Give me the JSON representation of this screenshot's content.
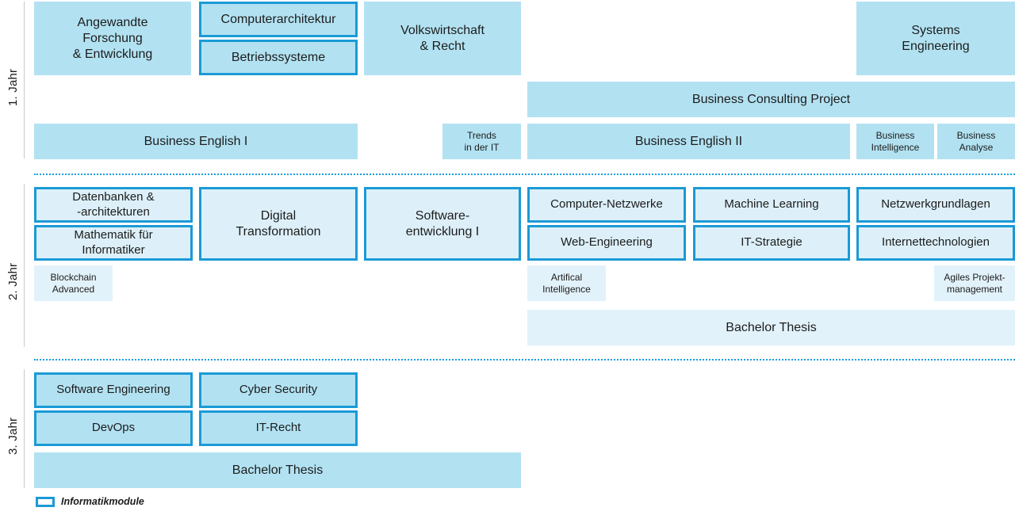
{
  "legend": {
    "swatch_label": "Informatikmodule",
    "swatch_border_color": "#1b9ad6"
  },
  "colors": {
    "accent": "#1b9ad6",
    "fill_strong": "#b2e2f2",
    "fill_soft": "#ddf0f9",
    "separator": "#14a0de",
    "text": "#1c1c1c"
  },
  "years": [
    {
      "label": "1. Jahr",
      "modules": [
        {
          "name": "Angewandte\nForschung\n& Entwicklung",
          "informatik": false
        },
        {
          "name": "Computerarchitektur",
          "informatik": true
        },
        {
          "name": "Betriebssysteme",
          "informatik": true
        },
        {
          "name": "Volkswirtschaft\n& Recht",
          "informatik": false
        },
        {
          "name": "Systems\nEngineering",
          "informatik": false
        },
        {
          "name": "Business Consulting Project",
          "informatik": false
        },
        {
          "name": "Business English I",
          "informatik": false
        },
        {
          "name": "Trends\nin der IT",
          "informatik": false
        },
        {
          "name": "Business English II",
          "informatik": false
        },
        {
          "name": "Business\nIntelligence",
          "informatik": false
        },
        {
          "name": "Business\nAnalyse",
          "informatik": false
        }
      ]
    },
    {
      "label": "2. Jahr",
      "modules": [
        {
          "name": "Datenbanken &\n-architekturen",
          "informatik": true
        },
        {
          "name": "Mathematik für\nInformatiker",
          "informatik": true
        },
        {
          "name": "Digital\nTransformation",
          "informatik": true
        },
        {
          "name": "Software-\nentwicklung I",
          "informatik": true
        },
        {
          "name": "Computer-Netzwerke",
          "informatik": true
        },
        {
          "name": "Web-Engineering",
          "informatik": true
        },
        {
          "name": "Machine Learning",
          "informatik": true
        },
        {
          "name": "IT-Strategie",
          "informatik": true
        },
        {
          "name": "Netzwerkgrundlagen",
          "informatik": true
        },
        {
          "name": "Internettechnologien",
          "informatik": true
        },
        {
          "name": "Blockchain\nAdvanced",
          "informatik": false
        },
        {
          "name": "Artifical\nIntelligence",
          "informatik": false
        },
        {
          "name": "Agiles Projekt-\nmanagement",
          "informatik": false
        },
        {
          "name": "Bachelor Thesis",
          "informatik": false
        }
      ]
    },
    {
      "label": "3. Jahr",
      "modules": [
        {
          "name": "Software Engineering",
          "informatik": true
        },
        {
          "name": "Cyber Security",
          "informatik": true
        },
        {
          "name": "DevOps",
          "informatik": true
        },
        {
          "name": "IT-Recht",
          "informatik": true
        },
        {
          "name": "Bachelor Thesis",
          "informatik": false
        }
      ]
    }
  ]
}
